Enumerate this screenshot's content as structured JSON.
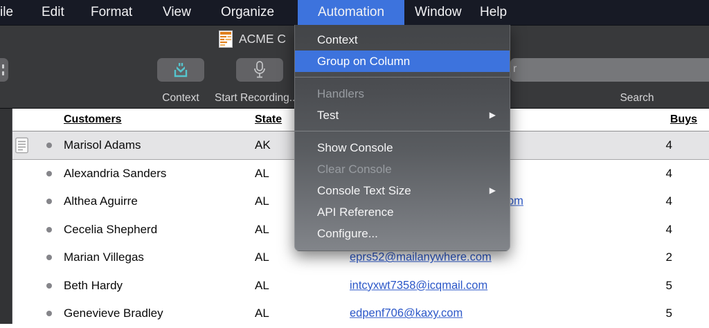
{
  "menu_bar": {
    "items": [
      "ile",
      "Edit",
      "Format",
      "View",
      "Organize",
      "Automation",
      "Window",
      "Help"
    ],
    "active_item": "Automation"
  },
  "automation_menu": {
    "items": [
      {
        "label": "Context"
      },
      {
        "label": "Group on Column",
        "highlighted": true
      },
      {
        "label": "Handlers",
        "disabled": true
      },
      {
        "label": "Test",
        "submenu": true
      },
      {
        "label": "Show Console"
      },
      {
        "label": "Clear Console",
        "disabled": true
      },
      {
        "label": "Console Text Size",
        "submenu": true
      },
      {
        "label": "API Reference"
      },
      {
        "label": "Configure..."
      }
    ],
    "submenu_arrow": "▶"
  },
  "window": {
    "title": "ACME C",
    "toolbar": {
      "context_label": "Context",
      "record_label": "Start Recording...",
      "search_label": "Search",
      "search_field_text": "r"
    }
  },
  "table": {
    "headers": {
      "customers": "Customers",
      "state": "State",
      "buys": "Buys"
    },
    "rows": [
      {
        "name": "Marisol Adams",
        "state": "AK",
        "email": "",
        "buys": "4"
      },
      {
        "name": "Alexandria Sanders",
        "state": "AL",
        "email": "",
        "buys": "4"
      },
      {
        "name": "Althea Aguirre",
        "state": "AL",
        "email": "om",
        "buys": "4"
      },
      {
        "name": "Cecelia Shepherd",
        "state": "AL",
        "email": "",
        "buys": "4"
      },
      {
        "name": "Marian Villegas",
        "state": "AL",
        "email": "eprs52@mailanywhere.com",
        "buys": "2"
      },
      {
        "name": "Beth Hardy",
        "state": "AL",
        "email": "intcyxwt7358@icqmail.com",
        "buys": "5"
      },
      {
        "name": "Genevieve Bradley",
        "state": "AL",
        "email": "edpenf706@kaxy.com",
        "buys": "5"
      }
    ]
  },
  "colors": {
    "menu_highlight": "#3d73dd",
    "menubar_bg": "#171a25",
    "toolbar_bg": "#38393b",
    "selected_row_bg": "#e4e4e6",
    "link": "#2b57c8",
    "context_icon": "#55c5ce"
  }
}
